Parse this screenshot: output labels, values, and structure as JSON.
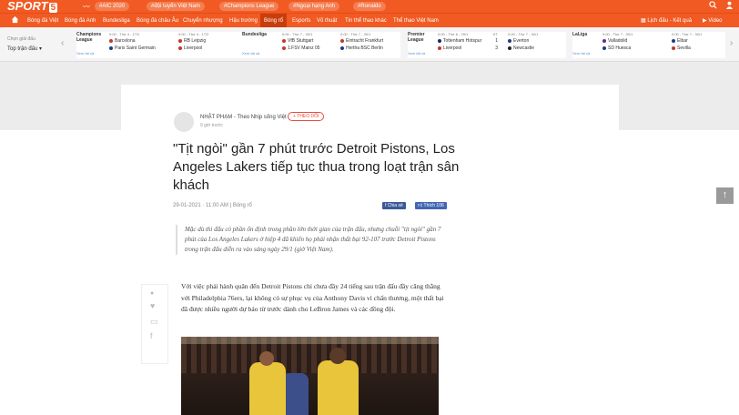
{
  "header": {
    "logo_text": "SPORT",
    "logo_num": "5",
    "tags": [
      "#AIC 2020",
      "#đội tuyển Việt Nam",
      "#Champions League",
      "#Ngoại hạng Anh",
      "#Ronaldo"
    ],
    "search_icon": "search-icon",
    "user_icon": "user-icon"
  },
  "nav": {
    "items": [
      "Bóng đá Việt",
      "Bóng đá Anh",
      "Bundesliga",
      "Bóng đá châu Âu",
      "Chuyển nhượng",
      "Hậu trường",
      "Bóng rổ",
      "Esports",
      "Võ thuật",
      "Tin thể thao khác",
      "Thể thao Việt Nam"
    ],
    "active_index": 6,
    "schedule": "Lịch đấu - Kết quả",
    "video": "Video"
  },
  "scorebar": {
    "label": "Chọn giải đấu",
    "select": "Top trận đấu",
    "leagues": [
      {
        "name": "Champions League",
        "link": "Xem tất cả",
        "matches": [
          {
            "time": "0:00 - Thứ 4 - 17/2",
            "home": "Barcelona",
            "away": "Paris Saint Germain",
            "hs": "",
            "as": "",
            "link": "Xem chi tiết"
          },
          {
            "time": "0:00 - Thứ 4 - 17/2",
            "home": "RB Leipzig",
            "away": "Liverpool",
            "hs": "",
            "as": "",
            "link": "Xem chi tiết"
          }
        ]
      },
      {
        "name": "Bundesliga",
        "link": "Xem tất cả",
        "matches": [
          {
            "time": "0:00 - Thứ 7 - 30/1",
            "home": "VfB Stuttgart",
            "away": "1.FSV Mainz 05",
            "hs": "",
            "as": "",
            "link": "Xem chi tiết"
          },
          {
            "time": "0:00 - Thứ 7 - 30/1",
            "home": "Eintracht Frankfurt",
            "away": "Hertha BSC Berlin",
            "hs": "",
            "as": "",
            "link": "Xem chi tiết"
          }
        ]
      },
      {
        "name": "Premier League",
        "link": "Xem tất cả",
        "matches": [
          {
            "time": "0:00 - Thứ 6 - 29/1",
            "home": "Tottenham Hotspur",
            "away": "Liverpool",
            "hs": "1",
            "as": "3",
            "link": "Xem chi tiết",
            "status": "KT"
          },
          {
            "time": "0:00 - Thứ 7 - 30/1",
            "home": "Everton",
            "away": "Newcastle",
            "hs": "",
            "as": "",
            "link": "Xem chi tiết"
          }
        ]
      },
      {
        "name": "LaLiga",
        "link": "Xem tất cả",
        "matches": [
          {
            "time": "0:00 - Thứ 7 - 30/1",
            "home": "Valladolid",
            "away": "SD Huesca",
            "hs": "",
            "as": "",
            "link": "Xem chi tiết"
          },
          {
            "time": "0:00 - Thứ 7 - 30/1",
            "home": "Elbar",
            "away": "Sevilla",
            "hs": "",
            "as": "",
            "link": "Xem chi tiết"
          }
        ]
      }
    ]
  },
  "article": {
    "author": "NHẬT PHẠM - Theo Nhịp sống Việt",
    "follow": "+ THEO DÕI",
    "ago": "9 giờ trước",
    "title": "\"Tịt ngòi\" gần 7 phút trước Detroit Pistons, Los Angeles Lakers tiếp tục thua trong loạt trận sân khách",
    "date": "29-01-2021 · 11:00 AM",
    "category": "Bóng rổ",
    "share_fb": "Chia sẻ",
    "like_fb": "Thích 106",
    "sapo": "Mặc dù thi đấu có phần ổn định trong phần lớn thời gian của trận đấu, nhưng chuỗi \"tịt ngòi\" gần 7 phút của Los Angeles Lakers ở hiệp 4 đã khiến họ phải nhận thất bại 92-107 trước Detroit Pistons trong trận đấu diễn ra vào sáng ngày 29/1 (giờ Việt Nam).",
    "body": "Với việc phải hành quân đến Detroit Pistons chỉ chưa đầy 24 tiếng sau trận đấu đầy căng thẳng với Philadelphia 76ers, lại không có sự phục vụ của Anthony Davis vì chấn thương, một thất bại đã được nhiều người dự báo từ trước dành cho LeBron James và các đồng đội."
  },
  "colors": {
    "brand": "#f15a22",
    "active_nav": "#c83d0b",
    "facebook": "#3b5998"
  }
}
